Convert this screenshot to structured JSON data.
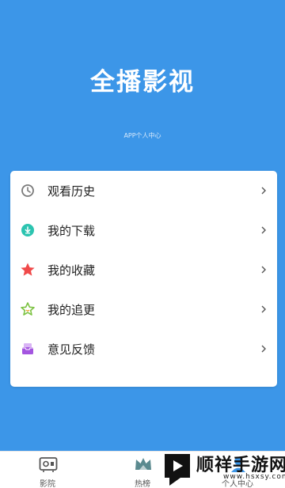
{
  "header": {
    "title": "全播影视",
    "subtitle": "APP个人中心"
  },
  "menu": {
    "items": [
      {
        "label": "观看历史",
        "icon": "clock-icon",
        "color": "#7a7a7a"
      },
      {
        "label": "我的下载",
        "icon": "download-icon",
        "color": "#2cc4b0"
      },
      {
        "label": "我的收藏",
        "icon": "star-filled-icon",
        "color": "#f04a4a"
      },
      {
        "label": "我的追更",
        "icon": "star-outline-icon",
        "color": "#7cc242"
      },
      {
        "label": "意见反馈",
        "icon": "inbox-icon",
        "color": "#a455e0"
      }
    ]
  },
  "tabbar": {
    "tabs": [
      {
        "label": "影院",
        "icon": "cinema-icon"
      },
      {
        "label": "热榜",
        "icon": "crown-icon"
      },
      {
        "label": "个人中心",
        "icon": "profile-icon"
      }
    ]
  },
  "watermark": {
    "text": "顺祥手游网",
    "url": "www.hsxsy.com"
  },
  "colors": {
    "background": "#3c96e8",
    "card": "#ffffff"
  }
}
